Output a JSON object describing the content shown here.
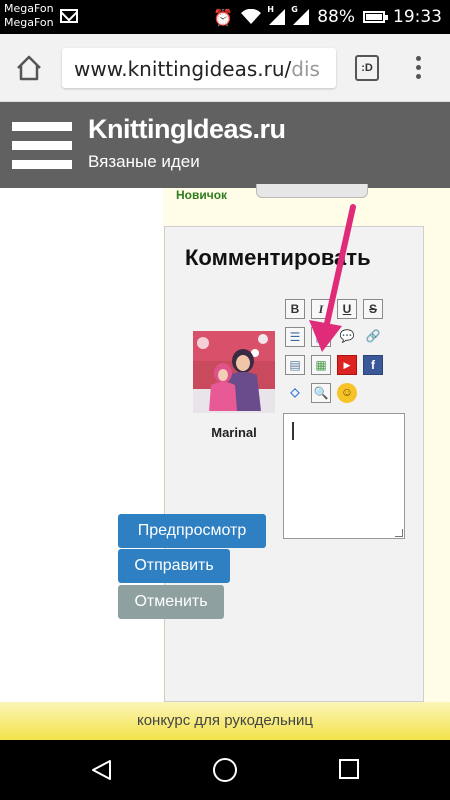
{
  "status_bar": {
    "carrier_1": "MegaFon",
    "carrier_2": "MegaFon",
    "network_1": "H",
    "network_2": "G",
    "battery_percent": "88%",
    "battery_level": 0.88,
    "time": "19:33"
  },
  "browser": {
    "url_main": "www.knittingideas.ru/",
    "url_tail": "dis",
    "tabs_label": ":D"
  },
  "site": {
    "title": "KnittingIdeas.ru",
    "subtitle": "Вязаные идеи"
  },
  "user": {
    "rank": "Новичок"
  },
  "comment": {
    "heading": "Комментировать",
    "username": "Marinal",
    "input_value": "",
    "toolbar": [
      {
        "icon": "bold-icon",
        "label": "B"
      },
      {
        "icon": "italic-icon",
        "label": "I"
      },
      {
        "icon": "underline-icon",
        "label": "U"
      },
      {
        "icon": "strikethrough-icon",
        "label": "S"
      },
      {
        "icon": "list-icon",
        "label": ""
      },
      {
        "icon": "image-upload-icon",
        "label": ""
      },
      {
        "icon": "quote-icon",
        "label": ""
      },
      {
        "icon": "link-icon",
        "label": ""
      },
      {
        "icon": "image-icon",
        "label": ""
      },
      {
        "icon": "insert-picture-icon",
        "label": ""
      },
      {
        "icon": "youtube-icon",
        "label": ""
      },
      {
        "icon": "facebook-icon",
        "label": ""
      },
      {
        "icon": "code-icon",
        "label": ""
      },
      {
        "icon": "search-image-icon",
        "label": ""
      },
      {
        "icon": "smiley-icon",
        "label": ""
      }
    ],
    "preview_label": "Предпросмотр",
    "send_label": "Отправить",
    "cancel_label": "Отменить"
  },
  "banner": {
    "text": "конкурс для рукодельниц"
  },
  "colors": {
    "header_bg": "#616161",
    "button_blue": "#2f80c2",
    "button_gray": "#8fa0a0",
    "arrow": "#e02c78",
    "rank_green": "#2e7d1e"
  }
}
